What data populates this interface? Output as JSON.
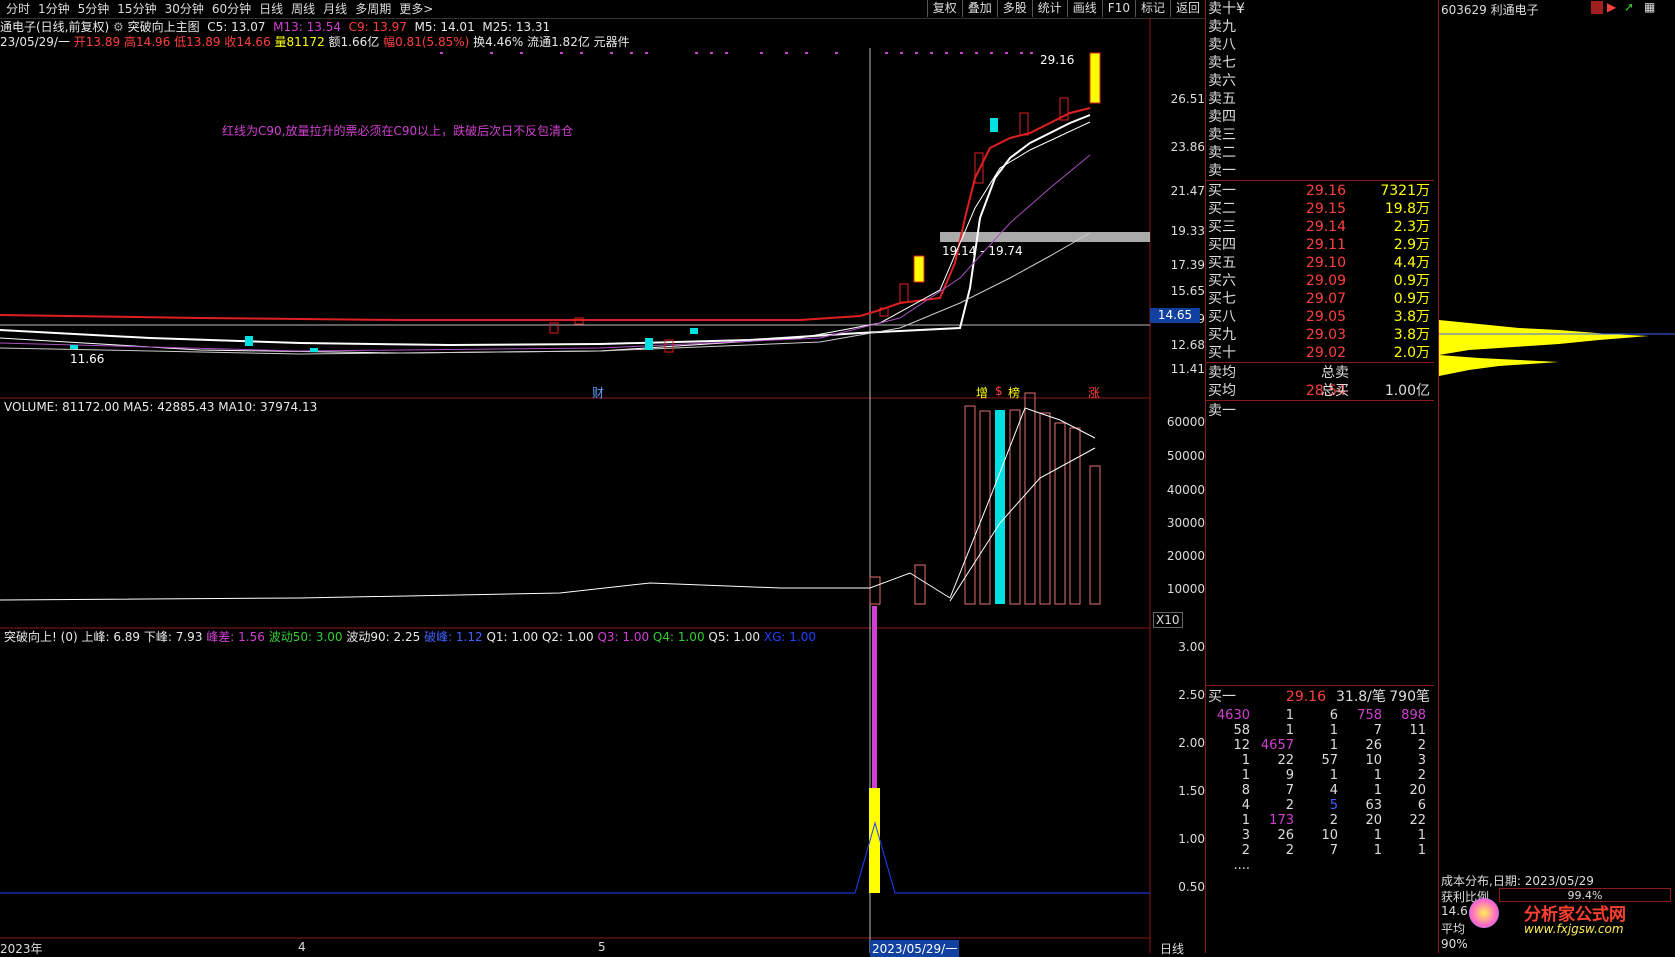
{
  "toolbar": {
    "periods": [
      "分时",
      "1分钟",
      "5分钟",
      "15分钟",
      "30分钟",
      "60分钟",
      "日线",
      "周线",
      "月线",
      "多周期",
      "更多>"
    ],
    "right": [
      "复权",
      "叠加",
      "多股",
      "统计",
      "画线",
      "F10",
      "标记",
      "返回"
    ]
  },
  "header": {
    "stock_title": "通电子(日线,前复权)",
    "indicator_name": "突破向上主图",
    "c5": "C5: 13.07",
    "m13": "M13: 13.54",
    "c9": "C9: 13.97",
    "m5": "M5: 14.01",
    "m25": "M25: 13.31",
    "date": "23/05/29/一",
    "open": "开13.89",
    "high": "高14.96",
    "low": "低13.89",
    "close": "收14.66",
    "vol": "量81172",
    "amount": "额1.66亿",
    "change": "幅0.81(5.85%)",
    "turnover": "换4.46%",
    "float": "流通1.82亿",
    "sector": "元器件"
  },
  "main_chart": {
    "note": "红线为C90,放量拉升的票必须在C90以上，跌破后次日不反包清仓",
    "price_labels": [
      "26.51",
      "23.86",
      "21.47",
      "19.33",
      "17.39",
      "15.65",
      "14.09",
      "12.68",
      "11.41"
    ],
    "current_price_tag": "14.65",
    "high_label": "29.16",
    "low_label": "11.66",
    "zone_label": "19.14 - 19.74",
    "event_marks": [
      "财",
      "增",
      "$",
      "榜",
      "涨"
    ]
  },
  "volume_chart": {
    "header": "VOLUME: 81172.00  MA5: 42885.43  MA10: 37974.13",
    "axis": [
      "60000",
      "50000",
      "40000",
      "30000",
      "20000",
      "10000"
    ],
    "unit": "X10"
  },
  "indicator_chart": {
    "title": "突破向上!",
    "param": "(0)",
    "up_peak": "上峰: 6.89",
    "down_peak": "下峰: 7.93",
    "peak_diff": "峰差: 1.56",
    "wave50": "波动50: 3.00",
    "wave90": "波动90: 2.25",
    "break": "破峰: 1.12",
    "q1": "Q1: 1.00",
    "q2": "Q2: 1.00",
    "q3": "Q3: 1.00",
    "q4": "Q4: 1.00",
    "q5": "Q5: 1.00",
    "xg": "XG: 1.00",
    "axis": [
      "3.00",
      "2.50",
      "2.00",
      "1.50",
      "1.00",
      "0.50"
    ]
  },
  "time_axis": {
    "labels": [
      "2023年",
      "4",
      "5",
      "2023/05/29/一"
    ],
    "period": "日线"
  },
  "order_book": {
    "sells": [
      "卖十¥",
      "卖九",
      "卖八",
      "卖七",
      "卖六",
      "卖五",
      "卖四",
      "卖三",
      "卖二",
      "卖一"
    ],
    "buys": [
      {
        "label": "买一",
        "price": "29.16",
        "vol": "7321万"
      },
      {
        "label": "买二",
        "price": "29.15",
        "vol": "19.8万"
      },
      {
        "label": "买三",
        "price": "29.14",
        "vol": "2.3万"
      },
      {
        "label": "买四",
        "price": "29.11",
        "vol": "2.9万"
      },
      {
        "label": "买五",
        "price": "29.10",
        "vol": "4.4万"
      },
      {
        "label": "买六",
        "price": "29.09",
        "vol": "0.9万"
      },
      {
        "label": "买七",
        "price": "29.07",
        "vol": "0.9万"
      },
      {
        "label": "买八",
        "price": "29.05",
        "vol": "3.8万"
      },
      {
        "label": "买九",
        "price": "29.03",
        "vol": "3.8万"
      },
      {
        "label": "买十",
        "price": "29.02",
        "vol": "2.0万"
      }
    ],
    "sell_avg_label": "卖均",
    "total_sell_label": "总卖",
    "buy_avg_label": "买均",
    "buy_avg": "28.54",
    "total_buy_label": "总买",
    "total_buy": "1.00亿",
    "sell_one_label": "卖一",
    "queue_head": {
      "label": "买一",
      "price": "29.16",
      "per": "31.8/笔",
      "count": "790笔"
    },
    "queue": [
      [
        "4630",
        "1",
        "6",
        "758",
        "898"
      ],
      [
        "58",
        "1",
        "1",
        "7",
        "11"
      ],
      [
        "12",
        "4657",
        "1",
        "26",
        "2"
      ],
      [
        "1",
        "22",
        "57",
        "10",
        "3"
      ],
      [
        "1",
        "9",
        "1",
        "1",
        "2"
      ],
      [
        "8",
        "7",
        "4",
        "1",
        "20"
      ],
      [
        "4",
        "2",
        "5",
        "63",
        "6"
      ],
      [
        "1",
        "173",
        "2",
        "20",
        "22"
      ],
      [
        "3",
        "26",
        "10",
        "1",
        "1"
      ],
      [
        "2",
        "2",
        "7",
        "1",
        "1"
      ]
    ],
    "more": "...."
  },
  "cost_panel": {
    "code_name": "603629 利通电子",
    "dist_label": "成本分布,日期:",
    "dist_date": "2023/05/29",
    "profit_label": "获利比例",
    "profit_value": "99.4%",
    "price_line": "14.6",
    "avg_label": "平均",
    "pct90": "90%",
    "watermark": "分析家公式网",
    "watermark_url": "www.fxjgsw.com"
  }
}
